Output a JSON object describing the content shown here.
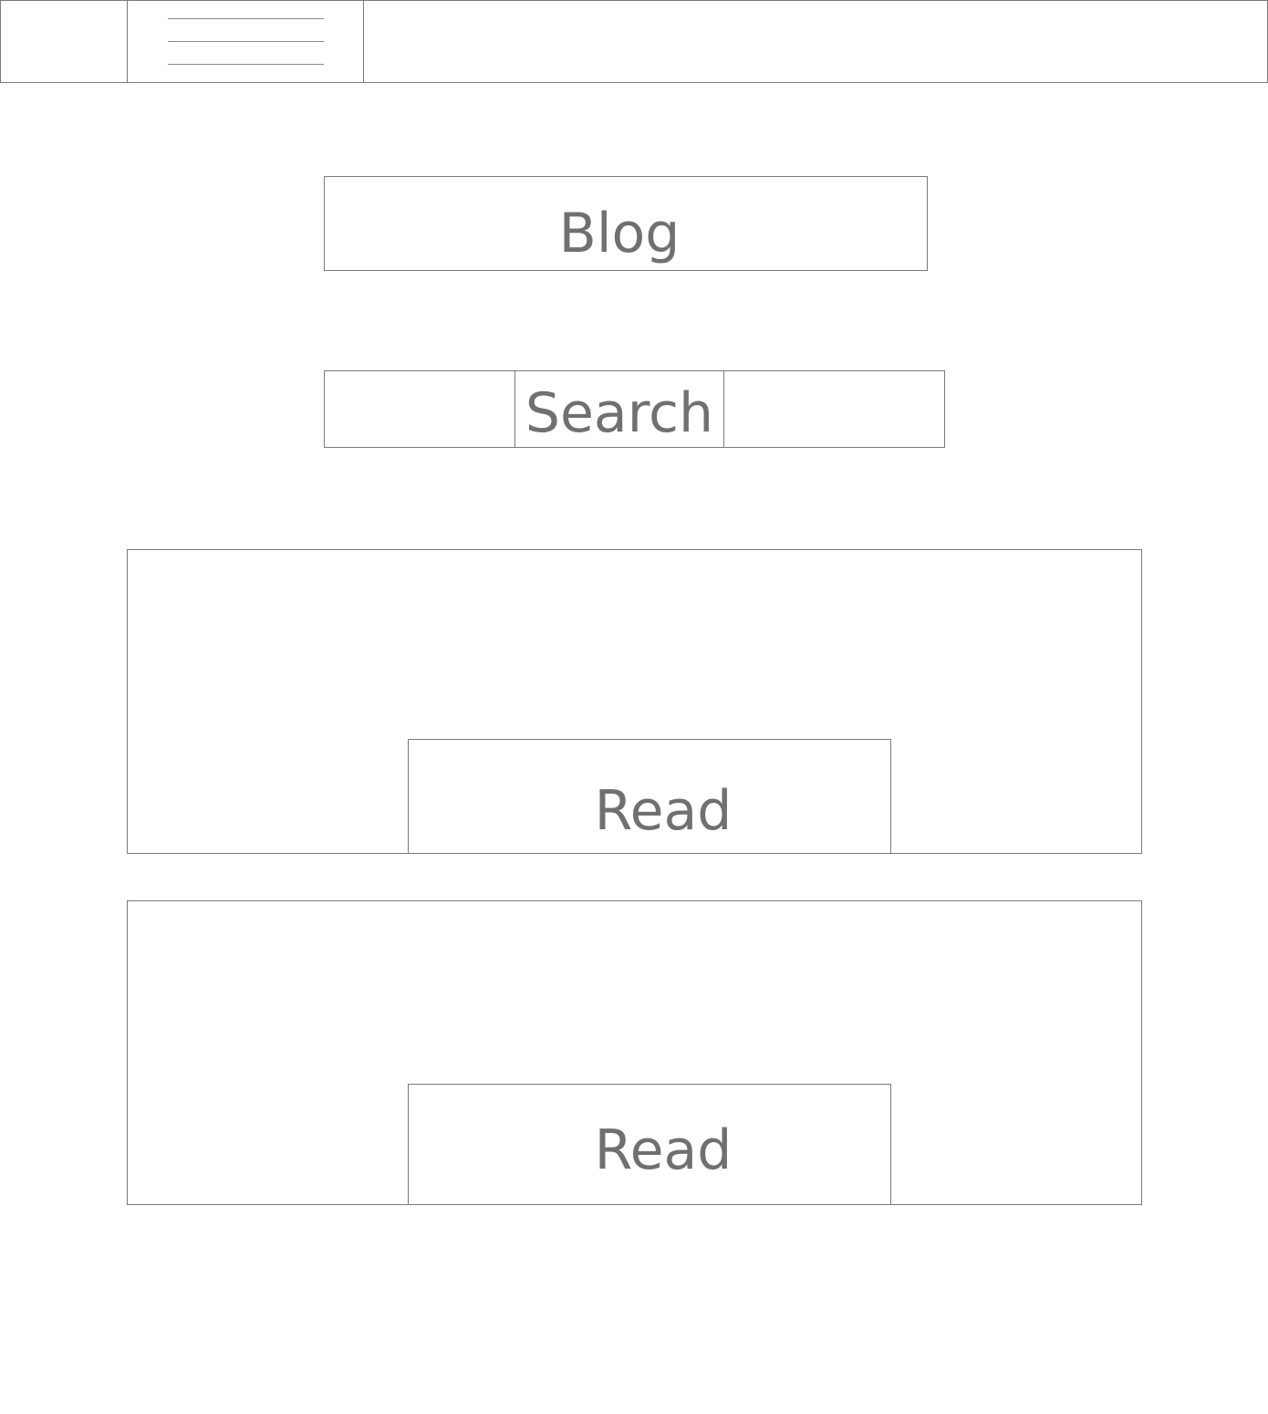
{
  "header": {
    "menu_icon": "hamburger-menu-icon"
  },
  "blog": {
    "title": "Blog"
  },
  "search": {
    "button_label": "Search"
  },
  "posts": [
    {
      "read_label": "Read"
    },
    {
      "read_label": "Read"
    }
  ],
  "colors": {
    "border": "#7a7a7a",
    "text": "#707070",
    "background": "#ffffff"
  }
}
